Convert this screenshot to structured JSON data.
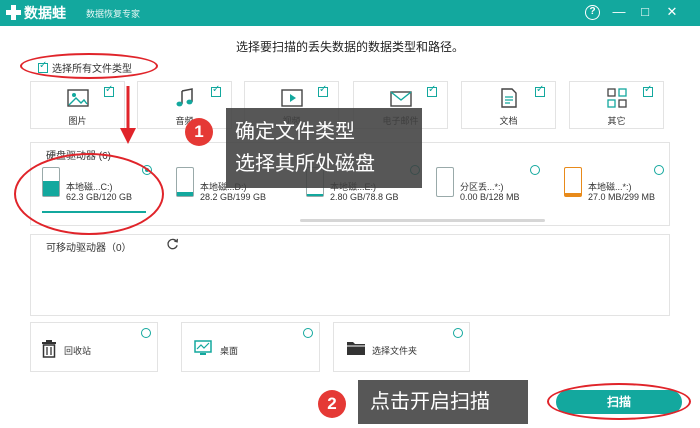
{
  "app": {
    "name": "数据蛙",
    "subtitle": "数据恢复专家",
    "help_label": "?",
    "minimize_label": "—",
    "maximize_label": "□",
    "close_label": "✕"
  },
  "main": {
    "title": "选择要扫描的丢失数据的数据类型和路径。",
    "select_all_label": "选择所有文件类型",
    "file_types": [
      {
        "label": "图片",
        "icon": "image-icon"
      },
      {
        "label": "音频",
        "icon": "music-icon"
      },
      {
        "label": "视频",
        "icon": "video-icon"
      },
      {
        "label": "电子邮件",
        "icon": "mail-icon"
      },
      {
        "label": "文档",
        "icon": "document-icon"
      },
      {
        "label": "其它",
        "icon": "other-icon"
      }
    ]
  },
  "drives": {
    "title": "硬盘驱动器 (6)",
    "items": [
      {
        "name": "本地磁...C:)",
        "size": "62.3 GB/120 GB",
        "fill": 0.52,
        "selected": true
      },
      {
        "name": "本地磁...D:)",
        "size": "28.2 GB/199 GB",
        "fill": 0.14,
        "selected": false
      },
      {
        "name": "本地磁...E:)",
        "size": "2.80 GB/78.8 GB",
        "fill": 0.04,
        "selected": false
      },
      {
        "name": "分区丢...*:)",
        "size": "0.00  B/128 MB",
        "fill": 0.0,
        "selected": false
      },
      {
        "name": "本地磁...*:)",
        "size": "27.0 MB/299 MB",
        "fill": 0.09,
        "selected": false
      }
    ]
  },
  "removable": {
    "title": "可移动驱动器（0）",
    "refresh_icon": "refresh-icon"
  },
  "locations": [
    {
      "label": "回收站",
      "icon": "trash-icon"
    },
    {
      "label": "桌面",
      "icon": "desktop-icon"
    },
    {
      "label": "选择文件夹",
      "icon": "folder-icon"
    }
  ],
  "scan_button": "扫描",
  "callouts": {
    "step1_badge": "1",
    "step1_line1": "确定文件类型",
    "step1_line2": "选择其所处磁盘",
    "step2_badge": "2",
    "step2_text": "点击开启扫描"
  },
  "colors": {
    "accent": "#13a89e",
    "annotation": "#e0242a"
  }
}
